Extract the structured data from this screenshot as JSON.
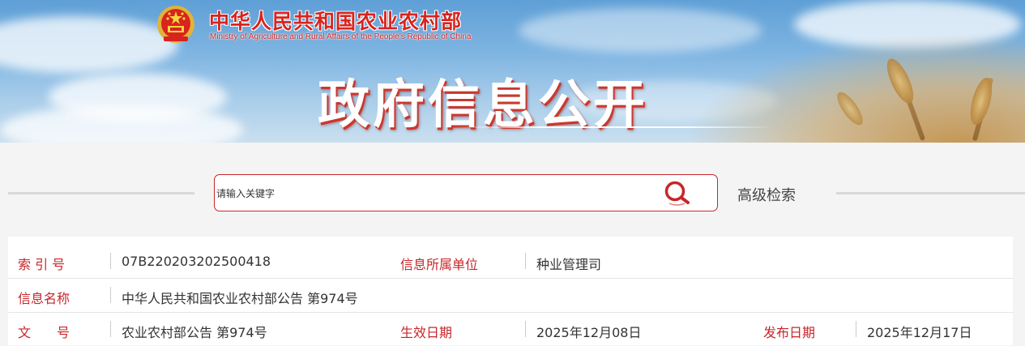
{
  "header": {
    "ministry_cn": "中华人民共和国农业农村部",
    "ministry_en": "Ministry of Agriculture and Rural Affairs of the People's Republic of China",
    "banner_title": "政府信息公开",
    "emblem_icon": "national-emblem-icon"
  },
  "search": {
    "placeholder": "请输入关键字",
    "search_icon": "search-icon",
    "advanced_label": "高级检索"
  },
  "info": {
    "rows": [
      [
        {
          "label": "索 引 号",
          "value": "07B220203202500418"
        },
        {
          "label": "信息所属单位",
          "value": "种业管理司"
        }
      ],
      [
        {
          "label": "信息名称",
          "value": "中华人民共和国农业农村部公告 第974号"
        }
      ],
      [
        {
          "label": "文　　号",
          "value": "农业农村部公告 第974号"
        },
        {
          "label": "生效日期",
          "value": "2025年12月08日"
        },
        {
          "label": "发布日期",
          "value": "2025年12月17日"
        }
      ]
    ]
  },
  "colors": {
    "accent_red": "#c8262a",
    "sky_blue": "#7fb5e2"
  }
}
